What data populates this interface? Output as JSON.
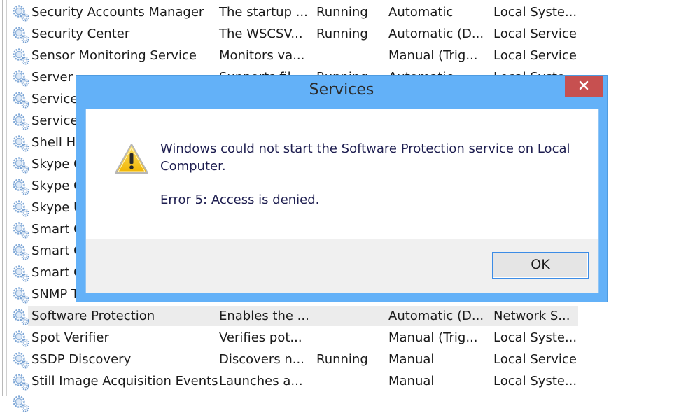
{
  "services": [
    {
      "name": "Security Accounts Manager",
      "description": "The startup ...",
      "status": "Running",
      "startup_type": "Automatic",
      "log_on_as": "Local Syste...",
      "icon": "gear-icon"
    },
    {
      "name": "Security Center",
      "description": "The WSCSV...",
      "status": "Running",
      "startup_type": "Automatic (D...",
      "log_on_as": "Local Service",
      "icon": "gear-icon"
    },
    {
      "name": "Sensor Monitoring Service",
      "description": "Monitors va...",
      "status": "",
      "startup_type": "Manual (Trig...",
      "log_on_as": "Local Service",
      "icon": "gear-icon"
    },
    {
      "name": "Server",
      "description": "Supports fil...",
      "status": "Running",
      "startup_type": "Automatic",
      "log_on_as": "Local Syste...",
      "icon": "gear-icon"
    },
    {
      "name": "Service",
      "description": "",
      "status": "",
      "startup_type": "",
      "log_on_as": "",
      "icon": "gear-icon"
    },
    {
      "name": "Servicel",
      "description": "",
      "status": "",
      "startup_type": "",
      "log_on_as": "",
      "icon": "gear-icon"
    },
    {
      "name": "Shell Ha",
      "description": "",
      "status": "",
      "startup_type": "",
      "log_on_as": "",
      "icon": "gear-icon"
    },
    {
      "name": "Skype C",
      "description": "",
      "status": "",
      "startup_type": "",
      "log_on_as": "",
      "icon": "gear-icon"
    },
    {
      "name": "Skype C",
      "description": "",
      "status": "",
      "startup_type": "",
      "log_on_as": "",
      "icon": "gear-icon"
    },
    {
      "name": "Skype U",
      "description": "",
      "status": "",
      "startup_type": "",
      "log_on_as": "",
      "icon": "gear-icon"
    },
    {
      "name": "Smart C",
      "description": "",
      "status": "",
      "startup_type": "",
      "log_on_as": "",
      "icon": "gear-icon"
    },
    {
      "name": "Smart C",
      "description": "",
      "status": "",
      "startup_type": "",
      "log_on_as": "",
      "icon": "gear-icon"
    },
    {
      "name": "Smart C",
      "description": "",
      "status": "",
      "startup_type": "",
      "log_on_as": "",
      "icon": "gear-icon"
    },
    {
      "name": "SNMP T",
      "description": "",
      "status": "",
      "startup_type": "",
      "log_on_as": "",
      "icon": "gear-icon"
    },
    {
      "name": "Software Protection",
      "description": "Enables the ...",
      "status": "",
      "startup_type": "Automatic (D...",
      "log_on_as": "Network S...",
      "icon": "gear-icon",
      "selected": true
    },
    {
      "name": "Spot Verifier",
      "description": "Verifies pot...",
      "status": "",
      "startup_type": "Manual (Trig...",
      "log_on_as": "Local Syste...",
      "icon": "gear-icon"
    },
    {
      "name": "SSDP Discovery",
      "description": "Discovers n...",
      "status": "Running",
      "startup_type": "Manual",
      "log_on_as": "Local Service",
      "icon": "gear-icon"
    },
    {
      "name": "Still Image Acquisition Events",
      "description": "Launches a...",
      "status": "",
      "startup_type": "Manual",
      "log_on_as": "Local Syste...",
      "icon": "gear-icon"
    },
    {
      "name": "",
      "description": "",
      "status": "",
      "startup_type": "",
      "log_on_as": "",
      "icon": "gear-icon"
    }
  ],
  "dialog": {
    "title": "Services",
    "close_icon": "close-icon",
    "icon": "warning-icon",
    "message": "Windows could not start the Software Protection service on Local Computer.",
    "error": "Error 5: Access is denied.",
    "ok_label": "OK"
  },
  "colors": {
    "dialog_frame": "#63b1f8",
    "close_button": "#c75050",
    "selected_row": "#ececec",
    "footer": "#f0f0f0",
    "ok_border": "#3c8ce6"
  }
}
